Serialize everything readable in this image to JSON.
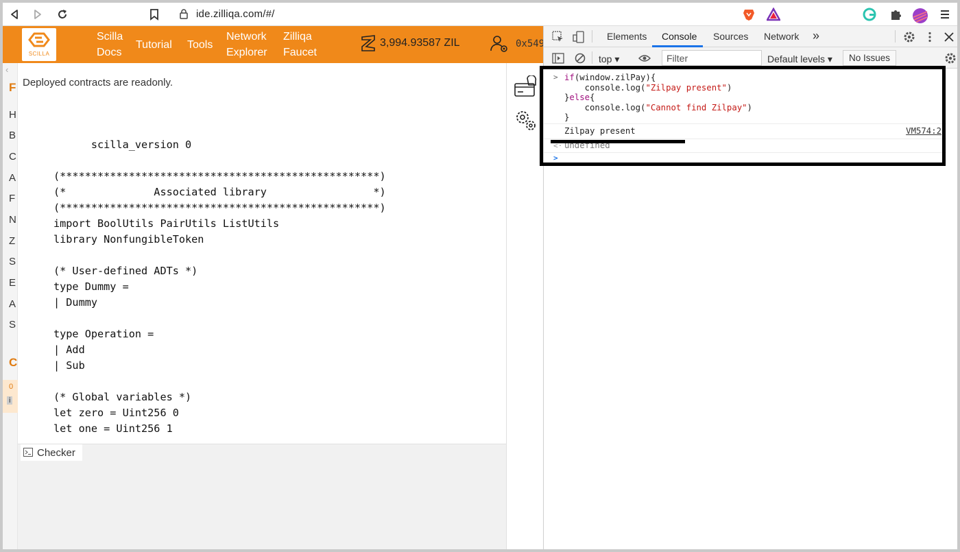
{
  "browser": {
    "url": "ide.zilliqa.com/#/"
  },
  "app": {
    "logo_word": "SCILLA",
    "nav": [
      {
        "line1": "Scilla",
        "line2": "Docs"
      },
      {
        "line1": "Tutorial",
        "line2": ""
      },
      {
        "line1": "Tools",
        "line2": ""
      },
      {
        "line1": "Network",
        "line2": "Explorer"
      },
      {
        "line1": "Zilliqa",
        "line2": "Faucet"
      }
    ],
    "balance": "3,994.93587 ZIL",
    "account_address": "0x549",
    "left_strip_letters": [
      "H",
      "B",
      "C",
      "A",
      "F",
      "N",
      "Z",
      "S",
      "E",
      "A",
      "S"
    ],
    "left_strip_top": "F",
    "left_strip_bottom": "C",
    "left_strip_small": [
      "0",
      "i"
    ],
    "readonly_notice": "Deployed contracts are readonly.",
    "code": [
      "      scilla_version 0",
      "",
      "(***************************************************)",
      "(*              Associated library                 *)",
      "(***************************************************)",
      "import BoolUtils PairUtils ListUtils",
      "library NonfungibleToken",
      "",
      "(* User-defined ADTs *)",
      "type Dummy =",
      "| Dummy",
      "",
      "type Operation =",
      "| Add",
      "| Sub",
      "",
      "(* Global variables *)",
      "let zero = Uint256 0",
      "let one = Uint256 1"
    ],
    "checker_tab": "Checker"
  },
  "devtools": {
    "tabs": [
      "Elements",
      "Console",
      "Sources",
      "Network"
    ],
    "active_tab": "Console",
    "more_tabs": "»",
    "context": "top",
    "filter_placeholder": "Filter",
    "levels": "Default levels",
    "issues": "No Issues",
    "console": {
      "input_lines": [
        "if(window.zilPay){",
        "    console.log(\"Zilpay present\")",
        "}else{",
        "    console.log(\"Cannot find Zilpay\")",
        "}"
      ],
      "output": "Zilpay present",
      "output_source": "VM574:2",
      "return_value": "undefined"
    }
  }
}
